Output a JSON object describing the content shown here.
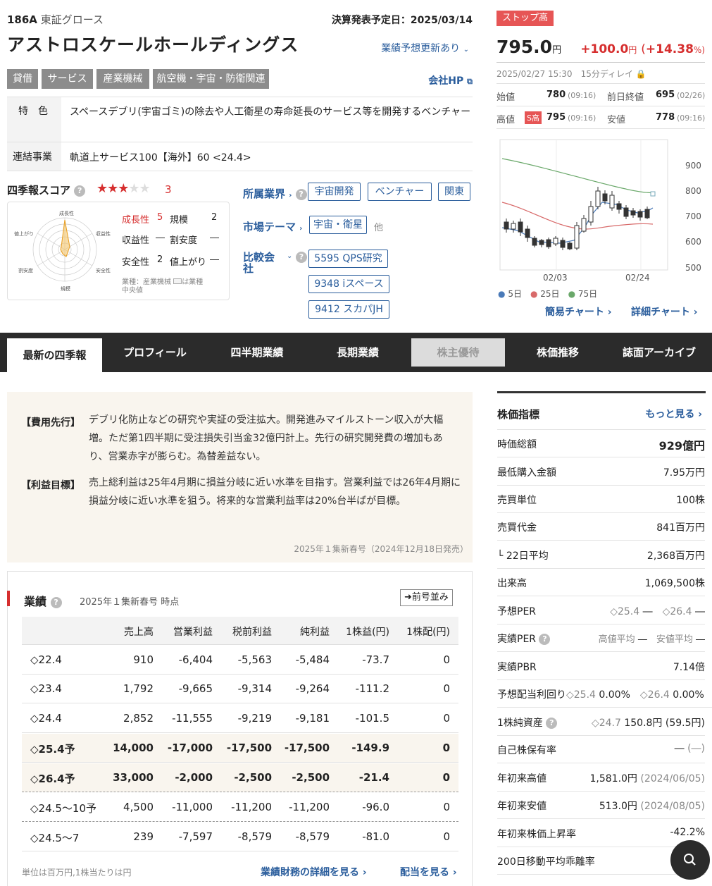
{
  "header": {
    "code": "186A",
    "market": "東証グロース",
    "settle_label": "決算発表予定日：2025/03/14",
    "name": "アストロスケールホールディングス",
    "forecast_update": "業績予想更新あり",
    "company_hp": "会社HP"
  },
  "tags": [
    "貸借",
    "サービス",
    "産業機械",
    "航空機・宇宙・防衛関連"
  ],
  "features": {
    "label": "特　色",
    "text": "スペースデブリ(宇宙ゴミ)の除去や人工衛星の寿命延長のサービス等を開発するベンチャー"
  },
  "business": {
    "label": "連結事業",
    "text": "軌道上サービス100【海外】60 <24.4>"
  },
  "score": {
    "title": "四季報スコア",
    "stars_filled": 3,
    "stars_total": 5,
    "value": "3",
    "items": [
      {
        "label": "成長性",
        "value": "5"
      },
      {
        "label": "規模",
        "value": "2"
      },
      {
        "label": "収益性",
        "value": "―"
      },
      {
        "label": "割安度",
        "value": "―"
      },
      {
        "label": "安全性",
        "value": "2"
      },
      {
        "label": "値上がり",
        "value": "―"
      }
    ],
    "note1": "業種：産業機械",
    "note2": "は業種",
    "note3": "中央値",
    "radar_labels": [
      "成長性",
      "収益性",
      "安全性",
      "規模",
      "割安度",
      "値上がり"
    ]
  },
  "industry": {
    "label": "所属業界",
    "chips": [
      "宇宙開発",
      "ベンチャー",
      "関東"
    ]
  },
  "theme": {
    "label": "市場テーマ",
    "chips": [
      "宇宙・衛星"
    ],
    "other": "他"
  },
  "compare": {
    "label": "比較会社",
    "chips": [
      "5595 QPS研究",
      "9348 iスペース",
      "9412 スカパJH"
    ]
  },
  "price": {
    "badge": "ストップ高",
    "value": "795.0",
    "unit": "円",
    "change": "+100.0",
    "change_unit": "円",
    "pct_open": "(",
    "pct": "+14.38",
    "pct_close": "%)",
    "datetime": "2025/02/27 15:30",
    "delay": "15分ディレイ",
    "open_label": "始値",
    "open": "780",
    "open_time": "(09:16)",
    "prev_label": "前日終値",
    "prev": "695",
    "prev_time": "(02/26)",
    "high_label": "高値",
    "high_badge": "S高",
    "high": "795",
    "high_time": "(09:16)",
    "low_label": "安値",
    "low": "778",
    "low_time": "(09:16)"
  },
  "chart_data": {
    "type": "candlestick",
    "y_ticks": [
      "900",
      "800",
      "700",
      "600",
      "500"
    ],
    "ylim": [
      500,
      900
    ],
    "x_ticks": [
      "02/03",
      "02/24"
    ],
    "legend": [
      "5日",
      "25日",
      "75日"
    ],
    "legend_colors": [
      "#4a7ab8",
      "#d86a6a",
      "#6aa86a"
    ]
  },
  "chart_links": {
    "simple": "簡易チャート",
    "detail": "詳細チャート"
  },
  "nav": [
    "最新の四季報",
    "プロフィール",
    "四半期業績",
    "長期業績",
    "株主優待",
    "株価推移",
    "誌面アーカイブ"
  ],
  "report": {
    "label1": "【費用先行】",
    "text1": "デブリ化防止などの研究や実証の受注拡大。開発進みマイルストーン収入が大幅増。ただ第1四半期に受注損失引当金32億円計上。先行の研究開発費の増加もあり、営業赤字が膨らむ。為替差益ない。",
    "label2": "【利益目標】",
    "text2": "売上総利益は25年4月期に損益分岐に近い水準を目指す。営業利益では26年4月期に損益分岐に近い水準を狙う。将来的な営業利益率は20%台半ばが目標。",
    "source": "2025年１集新春号（2024年12月18日発売）"
  },
  "results": {
    "title": "業績",
    "as_of": "2025年１集新春号 時点",
    "prev_button": "前号並み",
    "columns": [
      "",
      "売上高",
      "営業利益",
      "税前利益",
      "純利益",
      "1株益(円)",
      "1株配(円)"
    ],
    "rows": [
      [
        "◇22.4",
        "910",
        "-6,404",
        "-5,563",
        "-5,484",
        "-73.7",
        "0"
      ],
      [
        "◇23.4",
        "1,792",
        "-9,665",
        "-9,314",
        "-9,264",
        "-111.2",
        "0"
      ],
      [
        "◇24.4",
        "2,852",
        "-11,555",
        "-9,219",
        "-9,181",
        "-101.5",
        "0"
      ],
      [
        "◇25.4予",
        "14,000",
        "-17,000",
        "-17,500",
        "-17,500",
        "-149.9",
        "0"
      ],
      [
        "◇26.4予",
        "33,000",
        "-2,000",
        "-2,500",
        "-2,500",
        "-21.4",
        "0"
      ],
      [
        "◇24.5〜10予",
        "4,500",
        "-11,000",
        "-11,200",
        "-11,200",
        "-96.0",
        "0"
      ],
      [
        "◇24.5〜7",
        "239",
        "-7,597",
        "-8,579",
        "-8,579",
        "-81.0",
        "0"
      ]
    ],
    "unit_note": "単位は百万円,1株当たりは円",
    "detail_link": "業績財務の詳細を見る",
    "dividend_link": "配当を見る"
  },
  "indicators": {
    "title": "株価指標",
    "more": "もっと見る",
    "rows": [
      {
        "label": "時価総額",
        "value": "929億円"
      },
      {
        "label": "最低購入金額",
        "value": "7.95万円"
      },
      {
        "label": "売買単位",
        "value": "100株"
      },
      {
        "label": "売買代金",
        "value": "841百万円"
      },
      {
        "label": "└ 22日平均",
        "value": "2,368百万円"
      },
      {
        "label": "出来高",
        "value": "1,069,500株"
      }
    ],
    "per_label": "予想PER",
    "per_25": "◇25.4",
    "per_25v": "―",
    "per_26": "◇26.4",
    "per_26v": "―",
    "aper_label": "実績PER",
    "aper_high": "高値平均",
    "aper_high_v": "―",
    "aper_low": "安値平均",
    "aper_low_v": "―",
    "pbr_label": "実績PBR",
    "pbr": "7.14倍",
    "yield_label": "予想配当利回り",
    "yield_25": "◇25.4",
    "yield_25v": "0.00%",
    "yield_26": "◇26.4",
    "yield_26v": "0.00%",
    "bps_label": "1株純資産",
    "bps_tag": "◇24.7",
    "bps": "150.8円",
    "bps_pct": "(59.5円)",
    "treasury_label": "自己株保有率",
    "treasury": "―",
    "treasury_p": "(―)",
    "yhigh_label": "年初来高値",
    "yhigh": "1,581.0円",
    "yhigh_d": "(2024/06/05)",
    "ylow_label": "年初来安値",
    "ylow": "513.0円",
    "ylow_d": "(2024/08/05)",
    "yrate_label": "年初来株価上昇率",
    "yrate": "-42.2%",
    "ma_label": "200日移動平均乖離率"
  }
}
